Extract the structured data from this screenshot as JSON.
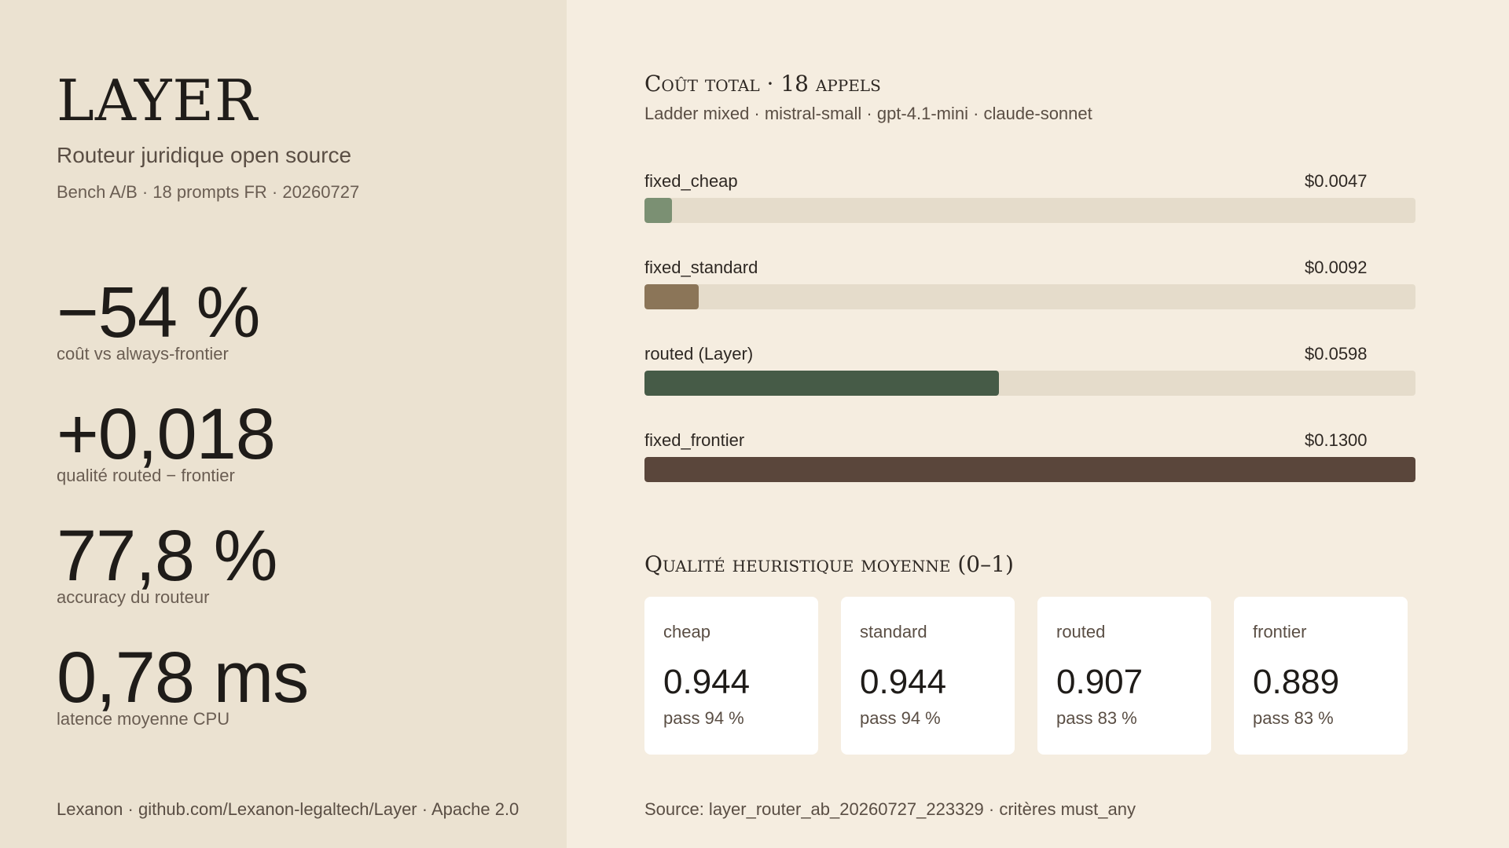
{
  "left": {
    "brand": "LAYER",
    "subtitle": "Routeur juridique open source",
    "meta": "Bench A/B · 18 prompts FR · 20260727",
    "kpis": [
      {
        "value": "−54 %",
        "label": "coût vs always-frontier"
      },
      {
        "value": "+0,018",
        "label": "qualité routed − frontier"
      },
      {
        "value": "77,8 %",
        "label": "accuracy du routeur"
      },
      {
        "value": "0,78 ms",
        "label": "latence moyenne CPU"
      }
    ],
    "footer": "Lexanon · github.com/Lexanon-legaltech/Layer · Apache 2.0"
  },
  "cost_section": {
    "title": "Coût total · 18 appels",
    "subtitle": "Ladder mixed · mistral-small · gpt-4.1-mini · claude-sonnet"
  },
  "quality_section": {
    "title": "Qualité heuristique moyenne (0–1)"
  },
  "footer_right": "Source: layer_router_ab_20260727_223329 · critères must_any",
  "chart_data": [
    {
      "type": "bar",
      "orientation": "horizontal",
      "title": "Coût total · 18 appels",
      "categories": [
        "fixed_cheap",
        "fixed_standard",
        "routed (Layer)",
        "fixed_frontier"
      ],
      "values": [
        0.0047,
        0.0092,
        0.0598,
        0.13
      ],
      "value_labels": [
        "$0.0047",
        "$0.0092",
        "$0.0598",
        "$0.1300"
      ],
      "xlim": [
        0,
        0.13
      ],
      "colors": [
        "#7b9073",
        "#8b7558",
        "#465b47",
        "#5a463b"
      ],
      "track_color": "#e5dccb"
    },
    {
      "type": "table",
      "title": "Qualité heuristique moyenne (0–1)",
      "categories": [
        "cheap",
        "standard",
        "routed",
        "frontier"
      ],
      "values": [
        0.944,
        0.944,
        0.907,
        0.889
      ],
      "value_labels": [
        "0.944",
        "0.944",
        "0.907",
        "0.889"
      ],
      "pass_labels": [
        "pass 94 %",
        "pass 94 %",
        "pass 83 %",
        "pass 83 %"
      ]
    }
  ]
}
